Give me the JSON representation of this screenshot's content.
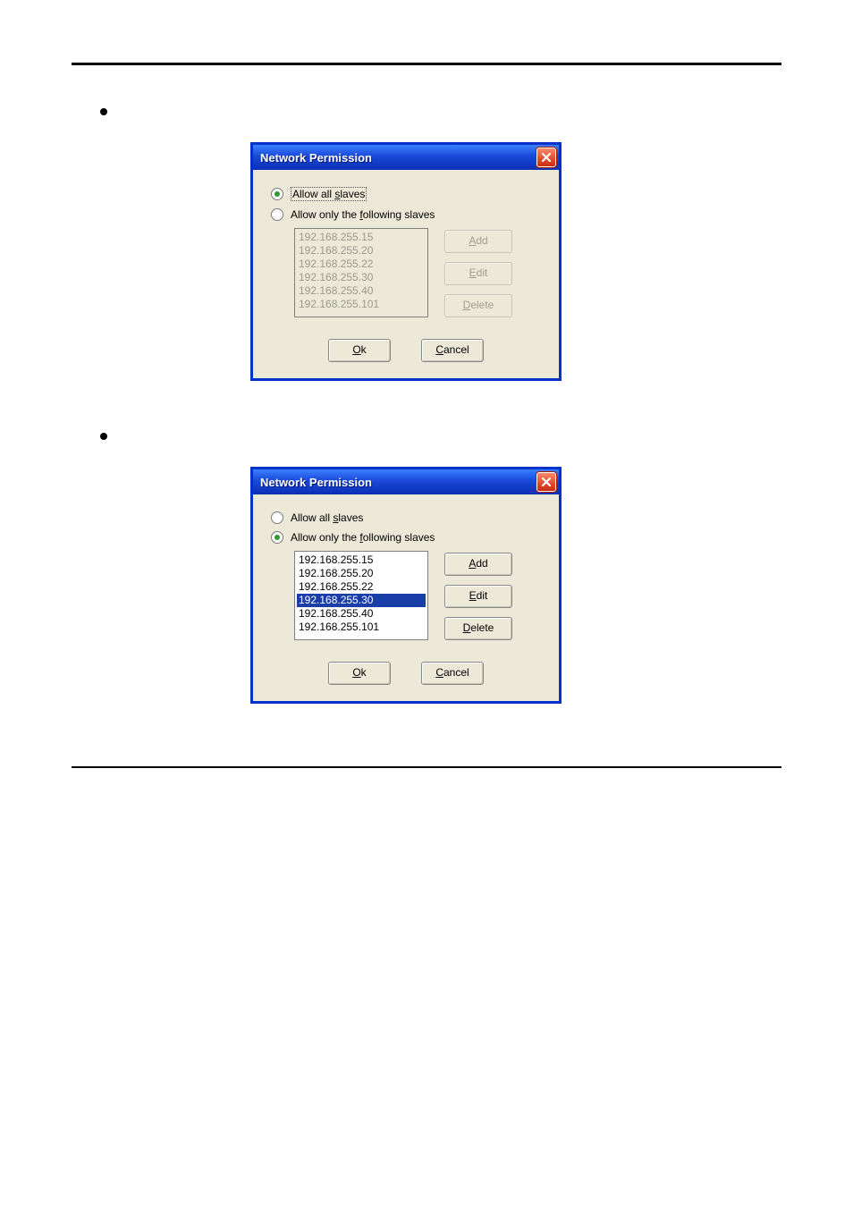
{
  "bullets": {
    "b1_pre": "",
    "b2_pre": ""
  },
  "dialog": {
    "title": "Network Permission",
    "radio1_pre": "Allow all ",
    "radio1_u": "s",
    "radio1_post": "laves",
    "radio2_pre": "Allow only the ",
    "radio2_u": "f",
    "radio2_post": "ollowing slaves",
    "ips": [
      "192.168.255.15",
      "192.168.255.20",
      "192.168.255.22",
      "192.168.255.30",
      "192.168.255.40",
      "192.168.255.101"
    ],
    "buttons": {
      "add_u": "A",
      "add_post": "dd",
      "edit_u": "E",
      "edit_post": "dit",
      "del_u": "D",
      "del_post": "elete",
      "ok_u": "O",
      "ok_post": "k",
      "cancel_u": "C",
      "cancel_post": "ancel"
    },
    "selected_index_in_dialog2": 3
  }
}
